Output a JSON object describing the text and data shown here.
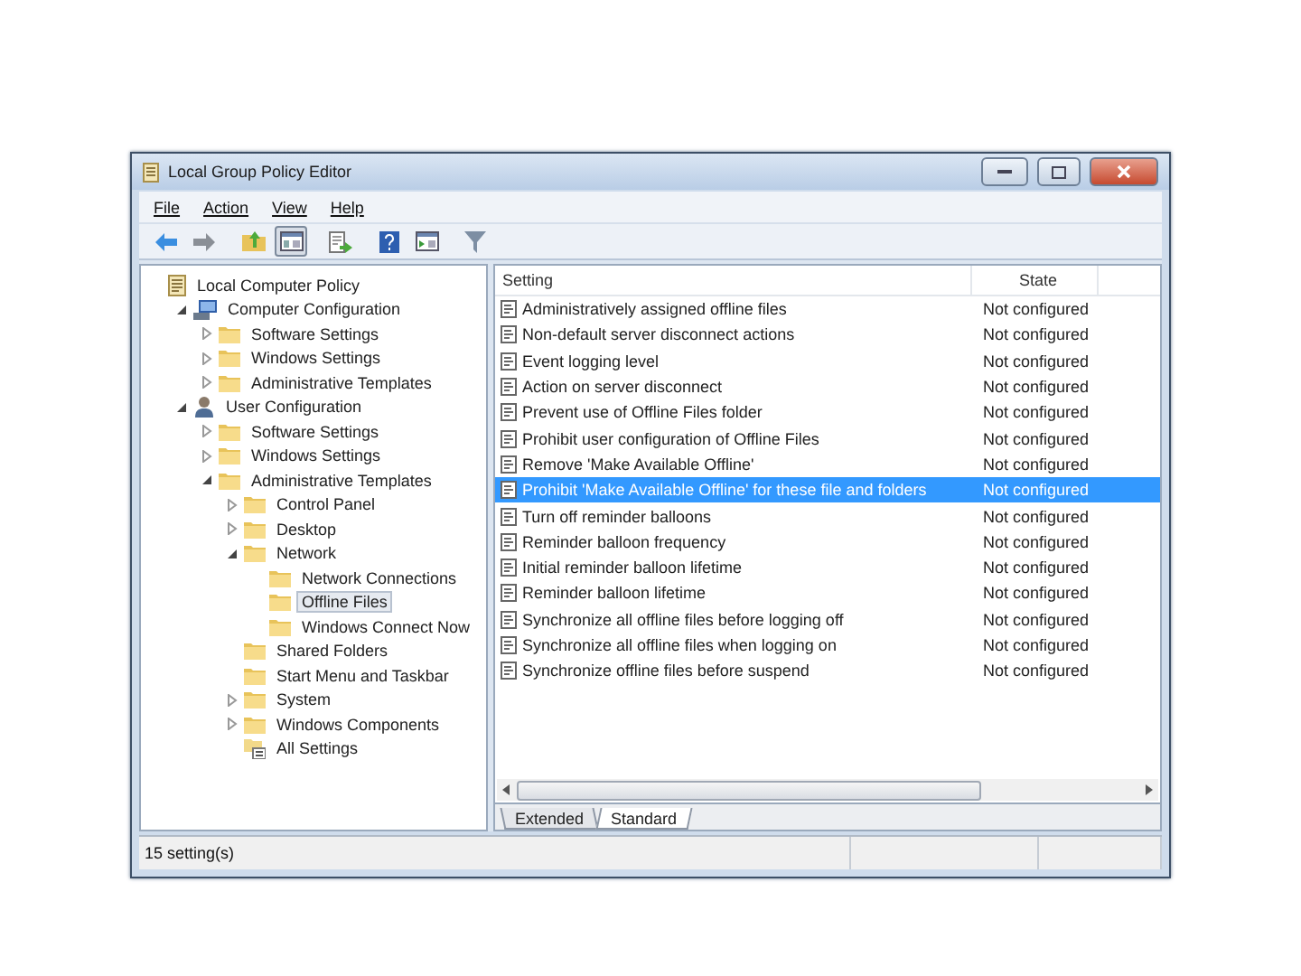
{
  "window": {
    "title": "Local Group Policy Editor"
  },
  "menu": [
    "File",
    "Action",
    "View",
    "Help"
  ],
  "toolbar": [
    {
      "kind": "back",
      "pressed": false
    },
    {
      "kind": "forward",
      "pressed": false
    },
    {
      "kind": "up",
      "pressed": false
    },
    {
      "kind": "tree",
      "pressed": true
    },
    {
      "kind": "export",
      "pressed": false
    },
    {
      "kind": "help",
      "pressed": false
    },
    {
      "kind": "pane",
      "pressed": false
    },
    {
      "kind": "filter",
      "pressed": false
    }
  ],
  "tree": [
    {
      "label": "Local Computer Policy",
      "kind": "policy",
      "selected": false,
      "children": [
        {
          "label": "Computer Configuration",
          "kind": "computer",
          "selected": false,
          "expanded": true,
          "children": [
            {
              "label": "Software Settings",
              "kind": "folder",
              "selected": false,
              "expanded": false
            },
            {
              "label": "Windows Settings",
              "kind": "folder",
              "selected": false,
              "expanded": false
            },
            {
              "label": "Administrative Templates",
              "kind": "folder",
              "selected": false,
              "expanded": false
            }
          ]
        },
        {
          "label": "User Configuration",
          "kind": "user",
          "selected": false,
          "expanded": true,
          "children": [
            {
              "label": "Software Settings",
              "kind": "folder",
              "selected": false,
              "expanded": false
            },
            {
              "label": "Windows Settings",
              "kind": "folder",
              "selected": false,
              "expanded": false
            },
            {
              "label": "Administrative Templates",
              "kind": "folder",
              "selected": false,
              "expanded": true,
              "children": [
                {
                  "label": "Control Panel",
                  "kind": "folder",
                  "selected": false,
                  "expanded": false
                },
                {
                  "label": "Desktop",
                  "kind": "folder",
                  "selected": false,
                  "expanded": false
                },
                {
                  "label": "Network",
                  "kind": "folder",
                  "selected": false,
                  "expanded": true,
                  "children": [
                    {
                      "label": "Network Connections",
                      "kind": "folder",
                      "selected": false
                    },
                    {
                      "label": "Offline Files",
                      "kind": "folder",
                      "selected": true
                    },
                    {
                      "label": "Windows Connect Now",
                      "kind": "folder",
                      "selected": false
                    }
                  ]
                },
                {
                  "label": "Shared Folders",
                  "kind": "folder",
                  "selected": false
                },
                {
                  "label": "Start Menu and Taskbar",
                  "kind": "folder",
                  "selected": false
                },
                {
                  "label": "System",
                  "kind": "folder",
                  "selected": false,
                  "expanded": false
                },
                {
                  "label": "Windows Components",
                  "kind": "folder",
                  "selected": false,
                  "expanded": false
                },
                {
                  "label": "All Settings",
                  "kind": "all",
                  "selected": false
                }
              ]
            }
          ]
        }
      ]
    }
  ],
  "table": {
    "columns": [
      "Setting",
      "State"
    ],
    "rows": [
      {
        "setting": "Administratively assigned offline files",
        "state": "Not configured",
        "selected": false
      },
      {
        "setting": "Non-default server disconnect actions",
        "state": "Not configured",
        "selected": false
      },
      {
        "setting": "Event logging level",
        "state": "Not configured",
        "selected": false
      },
      {
        "setting": "Action on server disconnect",
        "state": "Not configured",
        "selected": false
      },
      {
        "setting": "Prevent use of Offline Files folder",
        "state": "Not configured",
        "selected": false
      },
      {
        "setting": "Prohibit user configuration of Offline Files",
        "state": "Not configured",
        "selected": false
      },
      {
        "setting": "Remove 'Make Available Offline'",
        "state": "Not configured",
        "selected": false
      },
      {
        "setting": "Prohibit 'Make Available Offline' for these file and folders",
        "state": "Not configured",
        "selected": true
      },
      {
        "setting": "Turn off reminder balloons",
        "state": "Not configured",
        "selected": false
      },
      {
        "setting": "Reminder balloon frequency",
        "state": "Not configured",
        "selected": false
      },
      {
        "setting": "Initial reminder balloon lifetime",
        "state": "Not configured",
        "selected": false
      },
      {
        "setting": "Reminder balloon lifetime",
        "state": "Not configured",
        "selected": false
      },
      {
        "setting": "Synchronize all offline files before logging off",
        "state": "Not configured",
        "selected": false
      },
      {
        "setting": "Synchronize all offline files when logging on",
        "state": "Not configured",
        "selected": false
      },
      {
        "setting": "Synchronize offline files before suspend",
        "state": "Not configured",
        "selected": false
      }
    ]
  },
  "view_tabs": [
    {
      "label": "Extended",
      "selected": false
    },
    {
      "label": "Standard",
      "selected": true
    }
  ],
  "status_bar": "15 setting(s)"
}
